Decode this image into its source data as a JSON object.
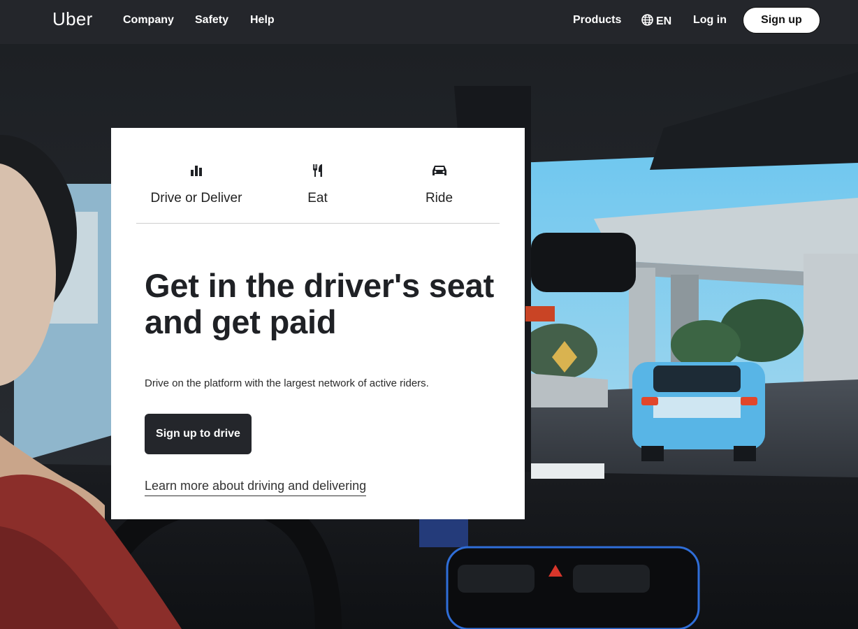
{
  "nav": {
    "logo": "Uber",
    "links": [
      "Company",
      "Safety",
      "Help"
    ],
    "right": {
      "products": "Products",
      "language": "EN",
      "login": "Log in",
      "signup": "Sign up"
    },
    "icons": {
      "language": "globe-icon"
    }
  },
  "card": {
    "tabs": [
      {
        "label": "Drive or Deliver",
        "icon": "bar-chart-icon"
      },
      {
        "label": "Eat",
        "icon": "fork-knife-icon"
      },
      {
        "label": "Ride",
        "icon": "car-icon"
      }
    ],
    "headline": "Get in the driver's seat and get paid",
    "description": "Drive on the platform with the largest network of active riders.",
    "cta": "Sign up to drive",
    "learn_more": "Learn more about driving and delivering"
  },
  "colors": {
    "nav_bg": "#24262b",
    "cta_bg": "#24262b",
    "text_dark": "#1f2125",
    "card_bg": "#ffffff"
  }
}
